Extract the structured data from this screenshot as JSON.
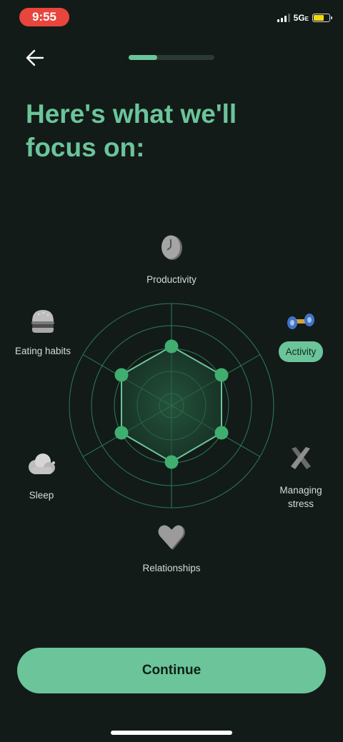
{
  "status_bar": {
    "time": "9:55",
    "network": "5G",
    "network_suffix": "E"
  },
  "header": {
    "progress_fraction": 0.33
  },
  "page": {
    "title": "Here's what we'll focus on:"
  },
  "focus_areas": {
    "productivity": {
      "label": "Productivity",
      "icon": "clock-icon"
    },
    "eating": {
      "label": "Eating habits",
      "icon": "burger-icon"
    },
    "activity": {
      "label": "Activity",
      "icon": "dumbbell-icon",
      "selected": true
    },
    "sleep": {
      "label": "Sleep",
      "icon": "cloud-icon"
    },
    "stress_line1": "Managing",
    "stress_line2": "stress",
    "stress_icon": "cross-icon",
    "relationships": {
      "label": "Relationships",
      "icon": "heart-icon"
    }
  },
  "colors": {
    "accent": "#6cc49a",
    "background": "#121b18",
    "status_time": "#e8453c"
  },
  "footer": {
    "continue_label": "Continue"
  }
}
